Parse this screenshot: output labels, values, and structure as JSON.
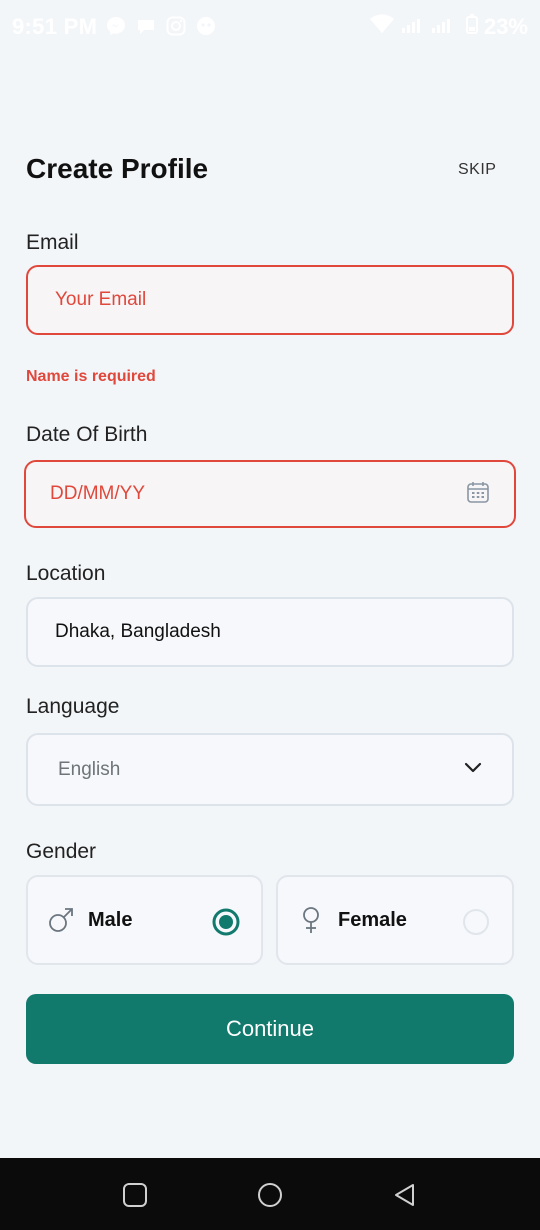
{
  "status_bar": {
    "time": "9:51 PM",
    "battery": "23%",
    "icons": [
      "messenger-icon",
      "chat-icon",
      "instagram-icon",
      "game-icon",
      "wifi-icon",
      "signal-icon",
      "battery-icon"
    ]
  },
  "header": {
    "title": "Create Profile",
    "skip_label": "SKIP"
  },
  "form": {
    "email": {
      "label": "Email",
      "placeholder": "Your Email",
      "error": "Name is required"
    },
    "dob": {
      "label": "Date Of Birth",
      "placeholder": "DD/MM/YY",
      "icon": "calendar-icon"
    },
    "location": {
      "label": "Location",
      "value": "Dhaka, Bangladesh"
    },
    "language": {
      "label": "Language",
      "value": "English",
      "icon": "chevron-down-icon"
    },
    "gender": {
      "label": "Gender",
      "options": [
        {
          "label": "Male",
          "icon": "male-icon",
          "selected": true
        },
        {
          "label": "Female",
          "icon": "female-icon",
          "selected": false
        }
      ]
    },
    "continue_label": "Continue"
  },
  "colors": {
    "accent": "#117a6d",
    "error": "#e0483c",
    "background": "#f3f6f9"
  },
  "nav_bar": {
    "icons": [
      "recent-apps-icon",
      "home-icon",
      "back-icon"
    ]
  }
}
